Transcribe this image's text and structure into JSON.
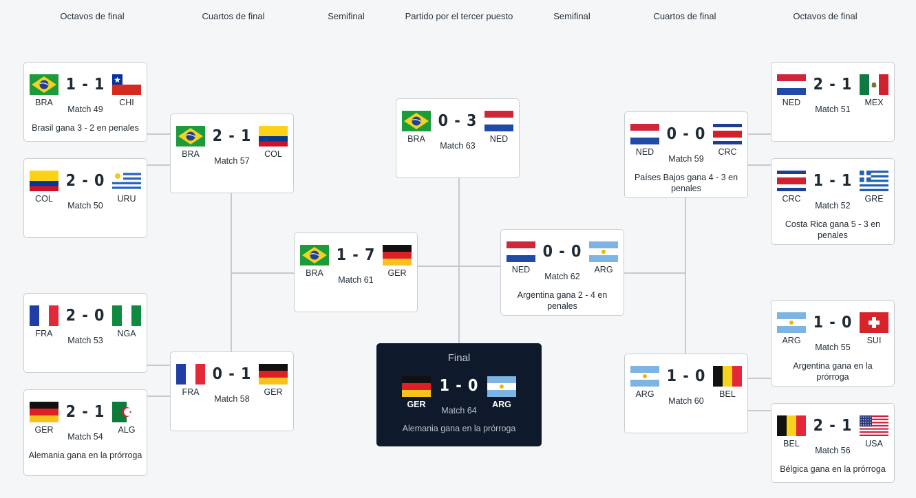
{
  "headers": [
    "Octavos de final",
    "Cuartos de final",
    "Semifinal",
    "Partido por el tercer puesto",
    "Semifinal",
    "Cuartos de final",
    "Octavos de final"
  ],
  "matches": [
    {
      "home": "BRA",
      "away": "CHI",
      "score": "1 - 1",
      "match": "Match 49",
      "note": "Brasil gana 3 - 2 en penales"
    },
    {
      "home": "COL",
      "away": "URU",
      "score": "2 - 0",
      "match": "Match 50",
      "note": ""
    },
    {
      "home": "FRA",
      "away": "NGA",
      "score": "2 - 0",
      "match": "Match 53",
      "note": ""
    },
    {
      "home": "GER",
      "away": "ALG",
      "score": "2 - 1",
      "match": "Match 54",
      "note": "Alemania gana en la prórroga"
    },
    {
      "home": "BRA",
      "away": "COL",
      "score": "2 - 1",
      "match": "Match 57",
      "note": ""
    },
    {
      "home": "FRA",
      "away": "GER",
      "score": "0 - 1",
      "match": "Match 58",
      "note": ""
    },
    {
      "home": "BRA",
      "away": "GER",
      "score": "1 - 7",
      "match": "Match 61",
      "note": ""
    },
    {
      "home": "BRA",
      "away": "NED",
      "score": "0 - 3",
      "match": "Match 63",
      "note": ""
    },
    {
      "home": "NED",
      "away": "ARG",
      "score": "0 - 0",
      "match": "Match 62",
      "note": "Argentina gana 2 - 4 en penales"
    },
    {
      "home": "NED",
      "away": "CRC",
      "score": "0 - 0",
      "match": "Match 59",
      "note": "Países Bajos gana 4 - 3 en penales"
    },
    {
      "home": "ARG",
      "away": "BEL",
      "score": "1 - 0",
      "match": "Match 60",
      "note": ""
    },
    {
      "home": "NED",
      "away": "MEX",
      "score": "2 - 1",
      "match": "Match 51",
      "note": ""
    },
    {
      "home": "CRC",
      "away": "GRE",
      "score": "1 - 1",
      "match": "Match 52",
      "note": "Costa Rica gana 5 - 3 en penales"
    },
    {
      "home": "ARG",
      "away": "SUI",
      "score": "1 - 0",
      "match": "Match 55",
      "note": "Argentina gana en la prórroga"
    },
    {
      "home": "BEL",
      "away": "USA",
      "score": "2 - 1",
      "match": "Match 56",
      "note": "Bélgica gana en la prórroga"
    }
  ],
  "final": {
    "title": "Final",
    "home": "GER",
    "away": "ARG",
    "score": "1 - 0",
    "match": "Match 64",
    "note": "Alemania gana en la prórroga"
  },
  "colors": {
    "background": "#f5f6f8",
    "card_border": "#c9ced4",
    "connector": "#b5bcc4",
    "final_background": "#0e1a2b"
  }
}
